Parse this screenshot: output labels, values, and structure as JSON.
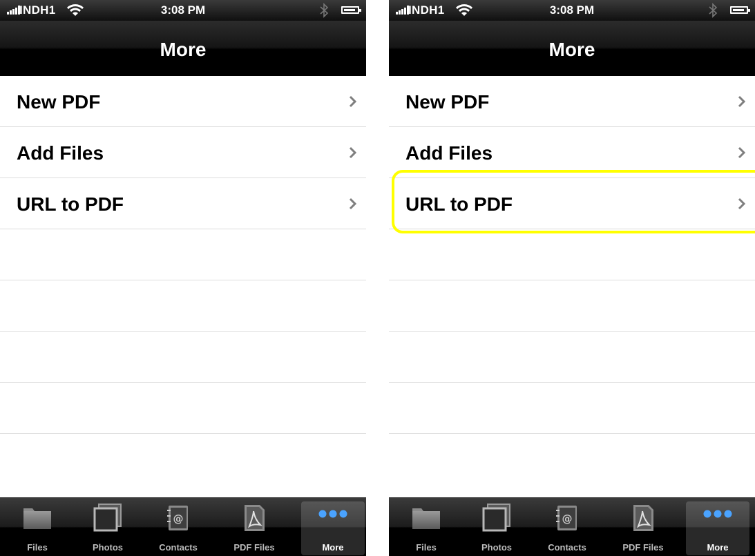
{
  "status_bar": {
    "carrier": "INDH1",
    "time": "3:08 PM"
  },
  "nav": {
    "title": "More"
  },
  "menu": [
    {
      "label": "New PDF"
    },
    {
      "label": "Add Files"
    },
    {
      "label": "URL to PDF"
    }
  ],
  "tabs": [
    {
      "label": "Files",
      "icon": "folder-icon"
    },
    {
      "label": "Photos",
      "icon": "photos-icon"
    },
    {
      "label": "Contacts",
      "icon": "contacts-icon"
    },
    {
      "label": "PDF Files",
      "icon": "pdf-file-icon"
    },
    {
      "label": "More",
      "icon": "more-icon",
      "selected": true
    }
  ],
  "colors": {
    "highlight": "#ffff00",
    "more_dots": "#4aa3ff"
  }
}
